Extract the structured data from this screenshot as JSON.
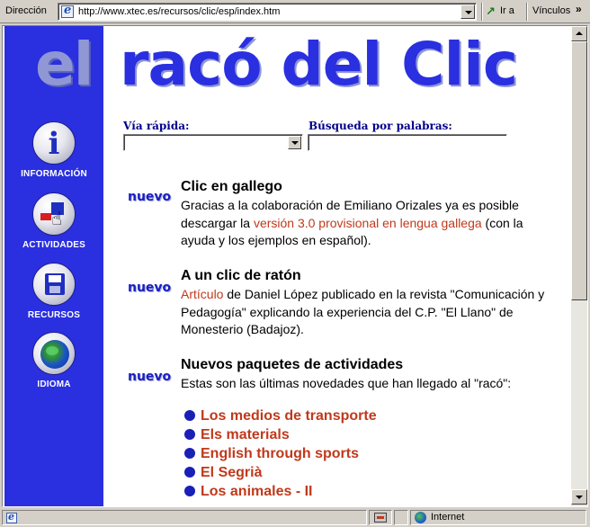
{
  "address_bar": {
    "label": "Dirección",
    "url": "http://www.xtec.es/recursos/clic/esp/index.htm",
    "go_label": "Ir a",
    "links_label": "Vínculos"
  },
  "logo": {
    "part1": "el",
    "part2": "racó del Clic"
  },
  "nav": [
    {
      "label": "INFORMACIÓN",
      "icon": "info-icon"
    },
    {
      "label": "ACTIVIDADES",
      "icon": "activities-icon"
    },
    {
      "label": "RECURSOS",
      "icon": "floppy-disk-icon"
    },
    {
      "label": "IDIOMA",
      "icon": "globe-icon"
    }
  ],
  "quick_access": {
    "label": "Vía rápida:",
    "value": ""
  },
  "keyword_search": {
    "label": "Búsqueda por palabras:",
    "value": ""
  },
  "news": [
    {
      "badge": "nuevo",
      "title": "Clic en gallego",
      "text1": "Gracias a la colaboración de Emiliano Orizales ya es posible descargar la ",
      "link": "versión 3.0 provisional en lengua gallega",
      "text2": " (con la ayuda y los ejemplos en español)."
    },
    {
      "badge": "nuevo",
      "title": "A un clic de ratón",
      "link": "Artículo",
      "text1": " de Daniel López publicado en la revista \"Comunicación y Pedagogía\" explicando la experiencia del C.P. \"El Llano\" de Monesterio (Badajoz)."
    },
    {
      "badge": "nuevo",
      "title": "Nuevos paquetes de actividades",
      "text1": "Estas son las últimas novedades que han llegado al \"racó\":"
    }
  ],
  "packages": [
    "Los medios de transporte",
    "Els materials",
    "English through sports",
    "El Segrià",
    "Los animales - II"
  ],
  "status_bar": {
    "zone": "Internet"
  },
  "colors": {
    "sidebar": "#2a2fe0",
    "link": "#c0391b",
    "label_blue": "#00008b",
    "chrome": "#d4d0c8"
  }
}
